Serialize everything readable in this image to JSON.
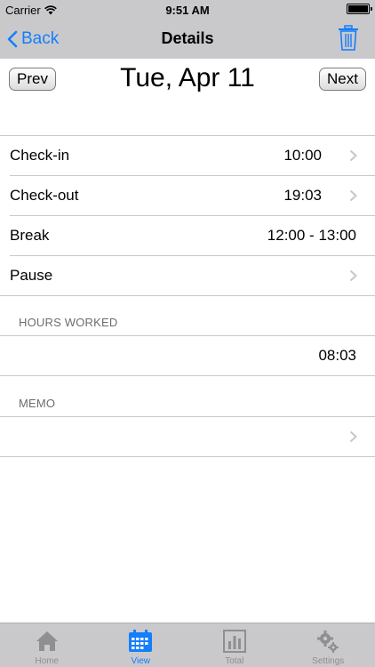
{
  "status_bar": {
    "carrier": "Carrier",
    "time": "9:51 AM"
  },
  "nav": {
    "back_label": "Back",
    "title": "Details"
  },
  "date_nav": {
    "prev_label": "Prev",
    "date": "Tue, Apr 11",
    "next_label": "Next"
  },
  "rows": [
    {
      "label": "Check-in",
      "value": "10:00"
    },
    {
      "label": "Check-out",
      "value": "19:03"
    },
    {
      "label": "Break",
      "value": "12:00 - 13:00"
    },
    {
      "label": "Pause",
      "value": ""
    }
  ],
  "hours_worked": {
    "header": "HOURS WORKED",
    "value": "08:03"
  },
  "memo": {
    "header": "MEMO",
    "value": ""
  },
  "tabs": [
    {
      "label": "Home",
      "icon": "home-icon",
      "active": false
    },
    {
      "label": "View",
      "icon": "calendar-icon",
      "active": true
    },
    {
      "label": "Total",
      "icon": "bar-chart-icon",
      "active": false
    },
    {
      "label": "Settings",
      "icon": "gear-icon",
      "active": false
    }
  ],
  "colors": {
    "accent": "#147efb",
    "bar_background": "#c9c9cb",
    "inactive_tab": "#8e8e93",
    "separator": "#c8c7cc"
  }
}
